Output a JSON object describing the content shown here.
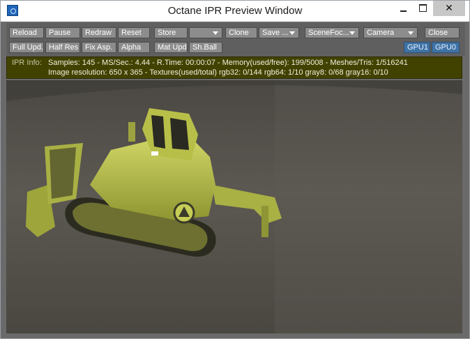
{
  "window": {
    "title": "Octane IPR Preview Window"
  },
  "toolbar": {
    "row1": [
      {
        "label": "Reload"
      },
      {
        "label": "Pause"
      },
      {
        "label": "Redraw"
      },
      {
        "label": "Reset"
      },
      {
        "label": "Store"
      },
      {
        "label": ""
      },
      {
        "label": "Clone"
      },
      {
        "label": "Save ..."
      },
      {
        "label": "SceneFoc..."
      },
      {
        "label": "Camera"
      },
      {
        "label": "Close"
      }
    ],
    "row2": [
      {
        "label": "Full Upd."
      },
      {
        "label": "Half Res"
      },
      {
        "label": "Fix Asp."
      },
      {
        "label": "Alpha"
      },
      {
        "label": "Mat Upd"
      },
      {
        "label": "Sh.Ball"
      },
      {
        "label": "GPU1"
      },
      {
        "label": "GPU0"
      }
    ]
  },
  "ipr_info": {
    "label": "IPR Info:",
    "line1": "Samples: 145  -  MS/Sec.: 4.44  -  R.Time: 00:00:07 - Memory(used/free): 199/5008  -  Meshes/Tris: 1/516241",
    "line2": "Image resolution: 650 x 365 - Textures(used/total) rgb32: 0/144  rgb64: 1/10   gray8: 0/68   gray16: 0/10"
  },
  "colors": {
    "button_bg": "#8c8c8c",
    "gpu_button_bg": "#3f73a6",
    "info_bg": "#424200",
    "bulldozer_body": "#b9c24a"
  },
  "viewport": {
    "icon": "bulldozer-render-icon"
  }
}
